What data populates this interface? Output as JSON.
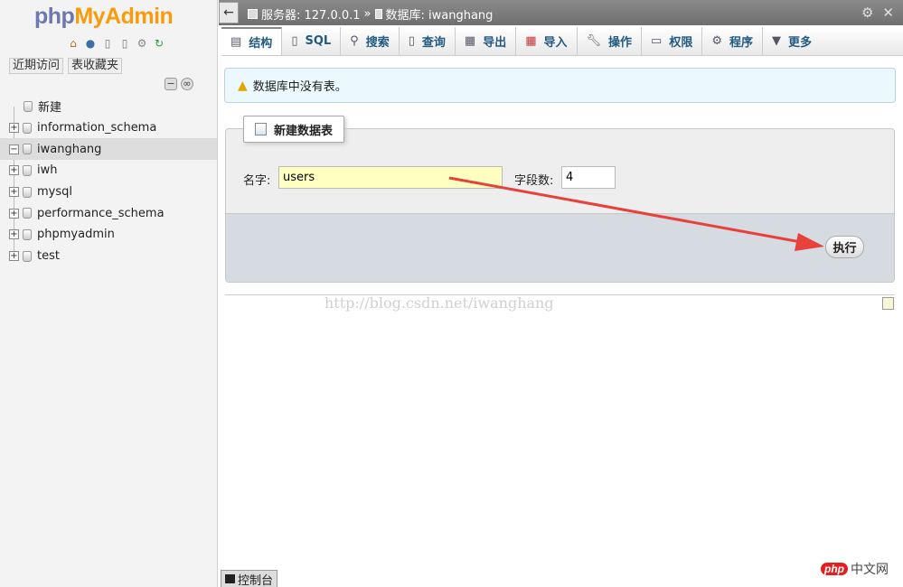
{
  "nav": {
    "logo_part1": "php",
    "logo_part2": "MyAdmin",
    "recent_label": "近期访问",
    "favorites_label": "表收藏夹",
    "new_label": "新建",
    "databases": [
      {
        "name": "information_schema"
      },
      {
        "name": "iwanghang",
        "active": true
      },
      {
        "name": "iwh"
      },
      {
        "name": "mysql"
      },
      {
        "name": "performance_schema"
      },
      {
        "name": "phpmyadmin"
      },
      {
        "name": "test"
      }
    ]
  },
  "topbar": {
    "server": "服务器: 127.0.0.1",
    "separator": "»",
    "database": "数据库: iwanghang"
  },
  "tabs": [
    {
      "label": "结构",
      "icon": "structure-icon",
      "active": true
    },
    {
      "label": "SQL",
      "icon": "sql-icon"
    },
    {
      "label": "搜索",
      "icon": "search-icon"
    },
    {
      "label": "查询",
      "icon": "query-icon"
    },
    {
      "label": "导出",
      "icon": "export-icon"
    },
    {
      "label": "导入",
      "icon": "import-icon"
    },
    {
      "label": "操作",
      "icon": "wrench-icon"
    },
    {
      "label": "权限",
      "icon": "privileges-icon"
    },
    {
      "label": "程序",
      "icon": "routines-icon"
    },
    {
      "label": "更多",
      "icon": "dropdown-icon"
    }
  ],
  "notice": {
    "text": "数据库中没有表。"
  },
  "create_table": {
    "legend": "新建数据表",
    "name_label": "名字:",
    "name_value": "users",
    "columns_label": "字段数:",
    "columns_value": "4",
    "submit_label": "执行"
  },
  "watermark": "http://blog.csdn.net/iwanghang",
  "console_label": "控制台",
  "brand": {
    "badge": "php",
    "text": "中文网"
  },
  "colors": {
    "arrow": "#e8403a",
    "name_input_bg": "#ffffbf",
    "notice_bg": "#ebf8fd"
  }
}
